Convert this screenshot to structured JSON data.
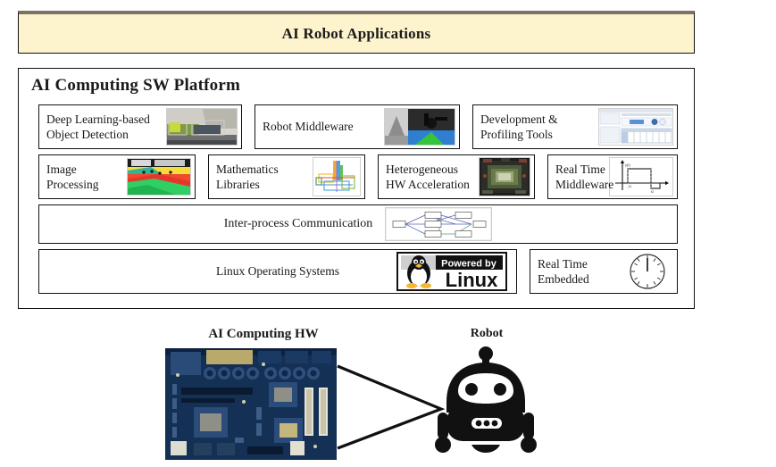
{
  "banner": {
    "title": "AI Robot Applications"
  },
  "platform": {
    "title": "AI Computing SW Platform",
    "rows": [
      {
        "name": "upper-services",
        "cells": [
          {
            "label": "Deep Learning-based\nObject Detection",
            "icon": "object-detection-thumbnail"
          },
          {
            "label": "Robot Middleware",
            "icon": "robot-simulation-thumbnail"
          },
          {
            "label": "Development &\nProfiling Tools",
            "icon": "profiler-ide-thumbnail"
          }
        ]
      },
      {
        "name": "core-libraries",
        "cells": [
          {
            "label": "Image\nProcessing",
            "icon": "segmented-image-thumbnail"
          },
          {
            "label": "Mathematics\nLibraries",
            "icon": "math-plot-thumbnail"
          },
          {
            "label": "Heterogeneous\nHW Acceleration",
            "icon": "gpu-chip-thumbnail"
          },
          {
            "label": "Real Time\nMiddleware",
            "icon": "timing-waveform-thumbnail"
          }
        ]
      },
      {
        "name": "communication",
        "cells": [
          {
            "label": "Inter-process Communication",
            "icon": "network-graph-thumbnail"
          }
        ]
      },
      {
        "name": "operating-systems",
        "cells": [
          {
            "label": "Linux Operating Systems",
            "icon": "powered-by-linux-logo",
            "logo_top": "Powered by",
            "logo_main": "Linux"
          },
          {
            "label": "Real Time\nEmbedded",
            "icon": "analog-clock-icon"
          }
        ]
      }
    ]
  },
  "hardware": {
    "label": "AI Computing HW",
    "icon": "motherboard-photo"
  },
  "robot": {
    "label": "Robot",
    "icon": "robot-silhouette-icon"
  },
  "colors": {
    "banner_fill": "#fdf3cd",
    "banner_top_edge": "#7d7363",
    "border": "#111111",
    "page_background": "#ffffff",
    "robot_fill": "#111111"
  }
}
